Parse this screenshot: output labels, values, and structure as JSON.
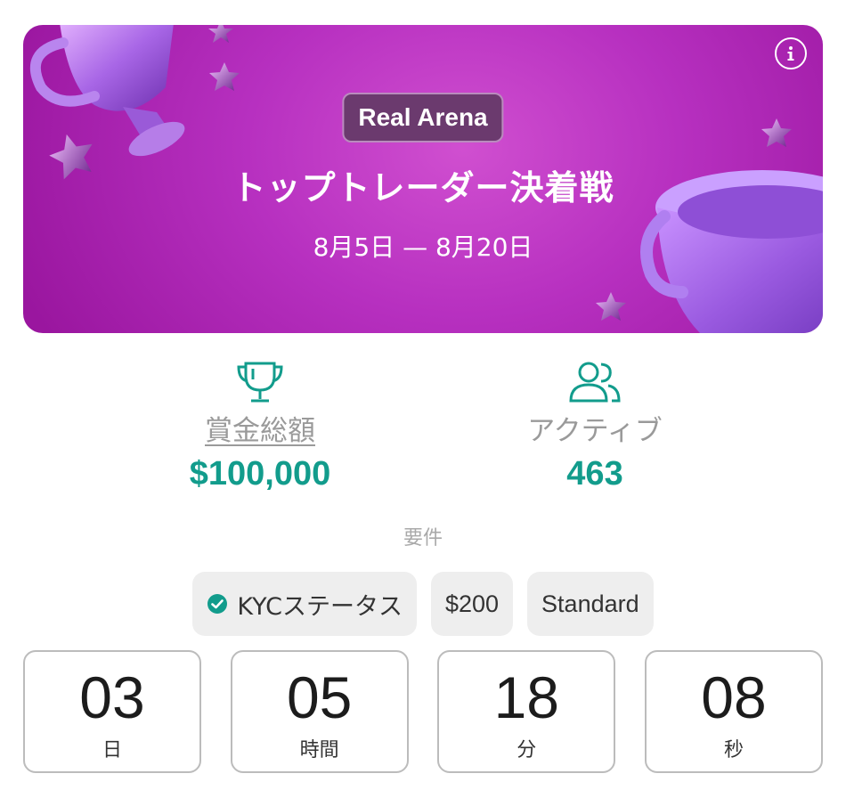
{
  "banner": {
    "badge": "Real Arena",
    "title": "トップトレーダー決着戦",
    "dates": "8月5日 — 8月20日",
    "info_icon": "info-icon"
  },
  "stats": {
    "prize": {
      "label": "賞金総額",
      "value": "$100,000",
      "icon": "trophy-icon"
    },
    "active": {
      "label": "アクティブ",
      "value": "463",
      "icon": "users-icon"
    }
  },
  "requirements": {
    "title": "要件",
    "chips": [
      {
        "label": "KYCステータス",
        "icon": "check-circle-icon"
      },
      {
        "label": "$200"
      },
      {
        "label": "Standard"
      }
    ]
  },
  "countdown": [
    {
      "value": "03",
      "unit": "日"
    },
    {
      "value": "05",
      "unit": "時間"
    },
    {
      "value": "18",
      "unit": "分"
    },
    {
      "value": "08",
      "unit": "秒"
    }
  ],
  "colors": {
    "accent_teal": "#129c8c",
    "banner_purple": "#b730c0",
    "badge_bg": "#6b3a6e"
  }
}
